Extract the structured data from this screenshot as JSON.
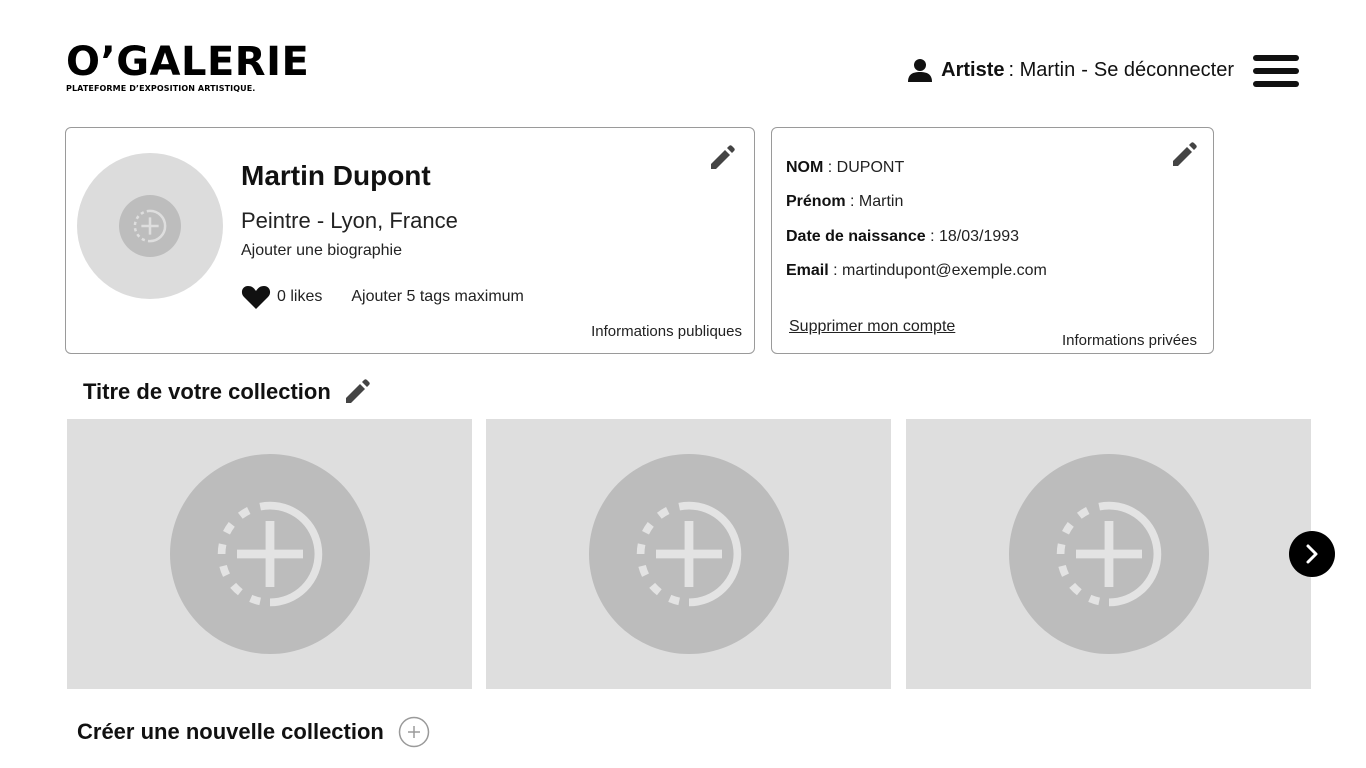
{
  "header": {
    "logo_title": "O’GALERIE",
    "logo_subtitle": "PLATEFORME D’EXPOSITION ARTISTIQUE.",
    "user_role": "Artiste",
    "user_name_text": ": Martin",
    "separator": "-",
    "logout_label": "Se déconnecter",
    "icons": {
      "user": "user-icon",
      "menu": "hamburger-menu-icon"
    }
  },
  "public_info": {
    "name": "Martin Dupont",
    "role_location": "Peintre -  Lyon, France",
    "bio_placeholder": "Ajouter une biographie",
    "likes": "0 likes",
    "tags_placeholder": "Ajouter 5 tags maximum",
    "caption": "Informations publiques"
  },
  "private_info": {
    "fields": [
      {
        "label": "NOM",
        "value": " : DUPONT"
      },
      {
        "label": "Prénom",
        "value": " : Martin"
      },
      {
        "label": "Date de naissance",
        "value": " : 18/03/1993"
      },
      {
        "label": "Email",
        "value": " : martindupont@exemple.com"
      }
    ],
    "delete_label": "Supprimer mon compte",
    "caption": "Informations privées"
  },
  "collection": {
    "title": "Titre de votre collection",
    "tiles": [
      "add-artwork",
      "add-artwork",
      "add-artwork"
    ],
    "new_collection_label": "Créer une nouvelle collection"
  },
  "colors": {
    "tile_bg": "#dedede",
    "circle_bg": "#bcbcbc",
    "card_border": "#9a9a9a",
    "accent": "#000000"
  }
}
